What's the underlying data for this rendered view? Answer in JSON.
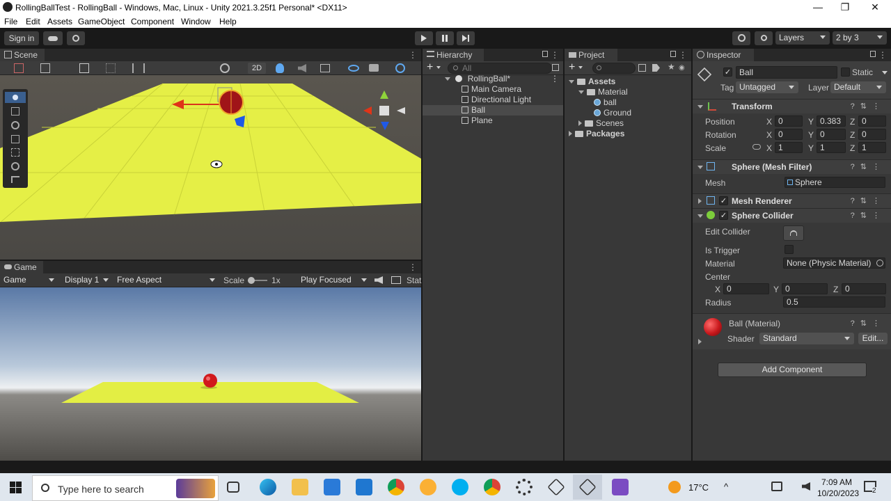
{
  "window": {
    "title": "RollingBallTest - RollingBall - Windows, Mac, Linux - Unity 2021.3.25f1 Personal* <DX11>",
    "minimize": "—",
    "maximize": "❐",
    "close": "✕"
  },
  "menu": [
    "File",
    "Edit",
    "Assets",
    "GameObject",
    "Component",
    "Window",
    "Help"
  ],
  "toolbar": {
    "sign_in": "Sign in",
    "layers": "Layers",
    "layout": "2 by 3"
  },
  "scene": {
    "tab": "Scene",
    "mode_2d": "2D"
  },
  "game": {
    "tab": "Game",
    "view_select": "Game",
    "display": "Display 1",
    "aspect": "Free Aspect",
    "scale_label": "Scale",
    "scale_value": "1x",
    "play_mode": "Play Focused",
    "stats": "Stat"
  },
  "hierarchy": {
    "tab": "Hierarchy",
    "search_placeholder": "All",
    "scene_name": "RollingBall*",
    "items": [
      "Main Camera",
      "Directional Light",
      "Ball",
      "Plane"
    ],
    "selected": "Ball"
  },
  "project": {
    "tab": "Project",
    "assets": "Assets",
    "material": "Material",
    "materials": [
      "ball",
      "Ground"
    ],
    "scenes": "Scenes",
    "packages": "Packages"
  },
  "inspector": {
    "tab": "Inspector",
    "object_name": "Ball",
    "static_label": "Static",
    "tag_label": "Tag",
    "tag_value": "Untagged",
    "layer_label": "Layer",
    "layer_value": "Default",
    "transform": {
      "title": "Transform",
      "position_label": "Position",
      "rotation_label": "Rotation",
      "scale_label": "Scale",
      "position": {
        "x": "0",
        "y": "0.383",
        "z": "0"
      },
      "rotation": {
        "x": "0",
        "y": "0",
        "z": "0"
      },
      "scale": {
        "x": "1",
        "y": "1",
        "z": "1"
      }
    },
    "mesh_filter": {
      "title": "Sphere (Mesh Filter)",
      "mesh_label": "Mesh",
      "mesh_value": "Sphere"
    },
    "mesh_renderer": {
      "title": "Mesh Renderer"
    },
    "sphere_collider": {
      "title": "Sphere Collider",
      "edit_collider": "Edit Collider",
      "is_trigger": "Is Trigger",
      "material_label": "Material",
      "material_value": "None (Physic Material)",
      "center_label": "Center",
      "center": {
        "x": "0",
        "y": "0",
        "z": "0"
      },
      "radius_label": "Radius",
      "radius_value": "0.5"
    },
    "material": {
      "title": "Ball (Material)",
      "shader_label": "Shader",
      "shader_value": "Standard",
      "edit": "Edit..."
    },
    "add_component": "Add Component",
    "axis_x": "X",
    "axis_y": "Y",
    "axis_z": "Z"
  },
  "taskbar": {
    "search_placeholder": "Type here to search",
    "temperature": "17°C",
    "time": "7:09 AM",
    "date": "10/20/2023",
    "notifications": "2"
  },
  "colors": {
    "plane_yellow": "#e8f04a",
    "ball_red": "#c8181c",
    "editor_bg": "#383838",
    "accent_blue": "#3c7fd8"
  }
}
